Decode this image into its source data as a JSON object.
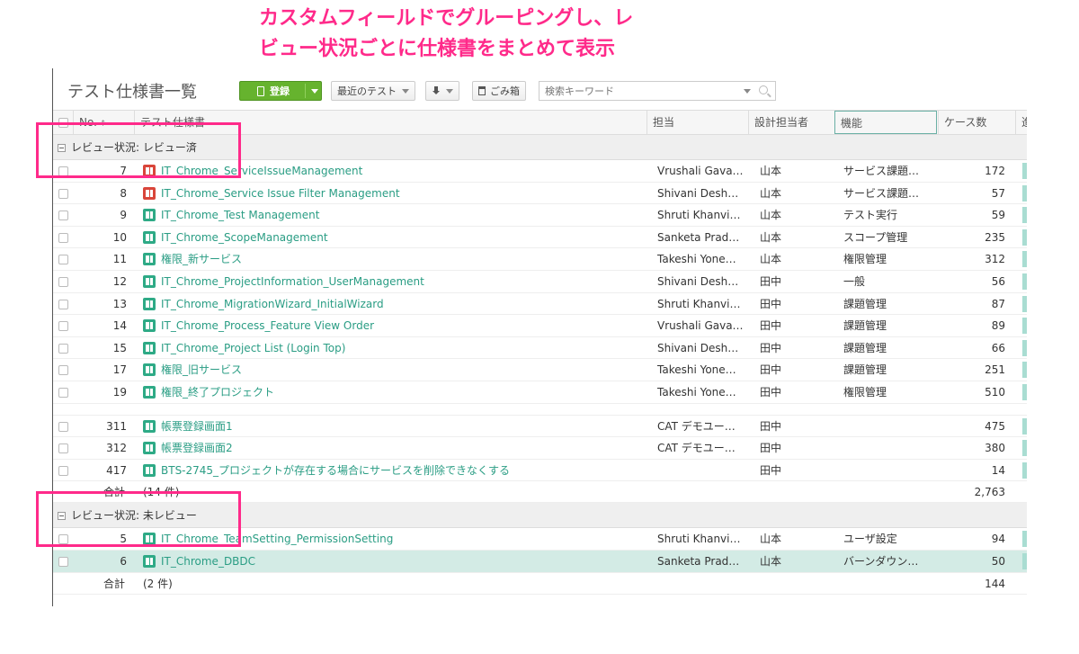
{
  "annotation": {
    "line1": "カスタムフィールドでグルーピングし、レ",
    "line2": "ビュー状況ごとに仕様書をまとめて表示"
  },
  "toolbar": {
    "title": "テスト仕様書一覧",
    "register_label": "登録",
    "recent_tests_label": "最近のテスト",
    "trash_label": "ごみ箱",
    "search_placeholder": "検索キーワード"
  },
  "columns": {
    "no": "No.",
    "name": "テスト仕様書",
    "assignee": "担当",
    "designer": "設計担当者",
    "function": "機能",
    "cases": "ケース数",
    "progress": "進"
  },
  "groups": [
    {
      "label": "レビュー状況: レビュー済",
      "rows": [
        {
          "no": "7",
          "icon": "red",
          "name": "IT_Chrome_ServiceIssueManagement",
          "assignee": "Vrushali Gava…",
          "designer": "山本",
          "function": "サービス課題…",
          "cases": "172"
        },
        {
          "no": "8",
          "icon": "red",
          "name": "IT_Chrome_Service Issue Filter Management",
          "assignee": "Shivani Desh…",
          "designer": "山本",
          "function": "サービス課題…",
          "cases": "57"
        },
        {
          "no": "9",
          "icon": "green",
          "name": "IT_Chrome_Test Management",
          "assignee": "Shruti Khanvi…",
          "designer": "山本",
          "function": "テスト実行",
          "cases": "59"
        },
        {
          "no": "10",
          "icon": "green",
          "name": "IT_Chrome_ScopeManagement",
          "assignee": "Sanketa Prad…",
          "designer": "山本",
          "function": "スコープ管理",
          "cases": "235"
        },
        {
          "no": "11",
          "icon": "green",
          "name": "権限_新サービス",
          "assignee": "Takeshi Yone…",
          "designer": "山本",
          "function": "権限管理",
          "cases": "312"
        },
        {
          "no": "12",
          "icon": "green",
          "name": "IT_Chrome_ProjectInformation_UserManagement",
          "assignee": "Shivani Desh…",
          "designer": "田中",
          "function": "一般",
          "cases": "56"
        },
        {
          "no": "13",
          "icon": "green",
          "name": "IT_Chrome_MigrationWizard_InitialWizard",
          "assignee": "Shruti Khanvi…",
          "designer": "田中",
          "function": "課題管理",
          "cases": "87"
        },
        {
          "no": "14",
          "icon": "green",
          "name": "IT_Chrome_Process_Feature View Order",
          "assignee": "Vrushali Gava…",
          "designer": "田中",
          "function": "課題管理",
          "cases": "89"
        },
        {
          "no": "15",
          "icon": "green",
          "name": "IT_Chrome_Project List (Login Top)",
          "assignee": "Shivani Desh…",
          "designer": "田中",
          "function": "課題管理",
          "cases": "66"
        },
        {
          "no": "17",
          "icon": "green",
          "name": "権限_旧サービス",
          "assignee": "Takeshi Yone…",
          "designer": "田中",
          "function": "課題管理",
          "cases": "251"
        },
        {
          "no": "19",
          "icon": "green",
          "name": "権限_終了プロジェクト",
          "assignee": "Takeshi Yone…",
          "designer": "田中",
          "function": "権限管理",
          "cases": "510"
        }
      ],
      "rows_after": [
        {
          "no": "311",
          "icon": "green",
          "name": "帳票登録画面1",
          "assignee": "CAT デモユー…",
          "designer": "田中",
          "function": "",
          "cases": "475"
        },
        {
          "no": "312",
          "icon": "green",
          "name": "帳票登録画面2",
          "assignee": "CAT デモユー…",
          "designer": "田中",
          "function": "",
          "cases": "380"
        },
        {
          "no": "417",
          "icon": "green",
          "name": "BTS-2745_プロジェクトが存在する場合にサービスを削除できなくする",
          "assignee": "",
          "designer": "田中",
          "function": "",
          "cases": "14"
        }
      ],
      "total_label": "合計",
      "total_count": "(14 件)",
      "total_cases": "2,763"
    },
    {
      "label": "レビュー状況: 未レビュー",
      "rows": [
        {
          "no": "5",
          "icon": "green",
          "name": "IT_Chrome_TeamSetting_PermissionSetting",
          "assignee": "Shruti Khanvi…",
          "designer": "山本",
          "function": "ユーザ設定",
          "cases": "94"
        },
        {
          "no": "6",
          "icon": "green",
          "name": "IT_Chrome_DBDC",
          "assignee": "Sanketa Prad…",
          "designer": "山本",
          "function": "バーンダウン…",
          "cases": "50",
          "highlighted": true
        }
      ],
      "total_label": "合計",
      "total_count": "(2 件)",
      "total_cases": "144"
    }
  ],
  "colors": {
    "annotation": "#ff2a8a",
    "link": "#2a9d84",
    "register_button": "#66b32e",
    "highlight_row": "#d3ebe5"
  }
}
